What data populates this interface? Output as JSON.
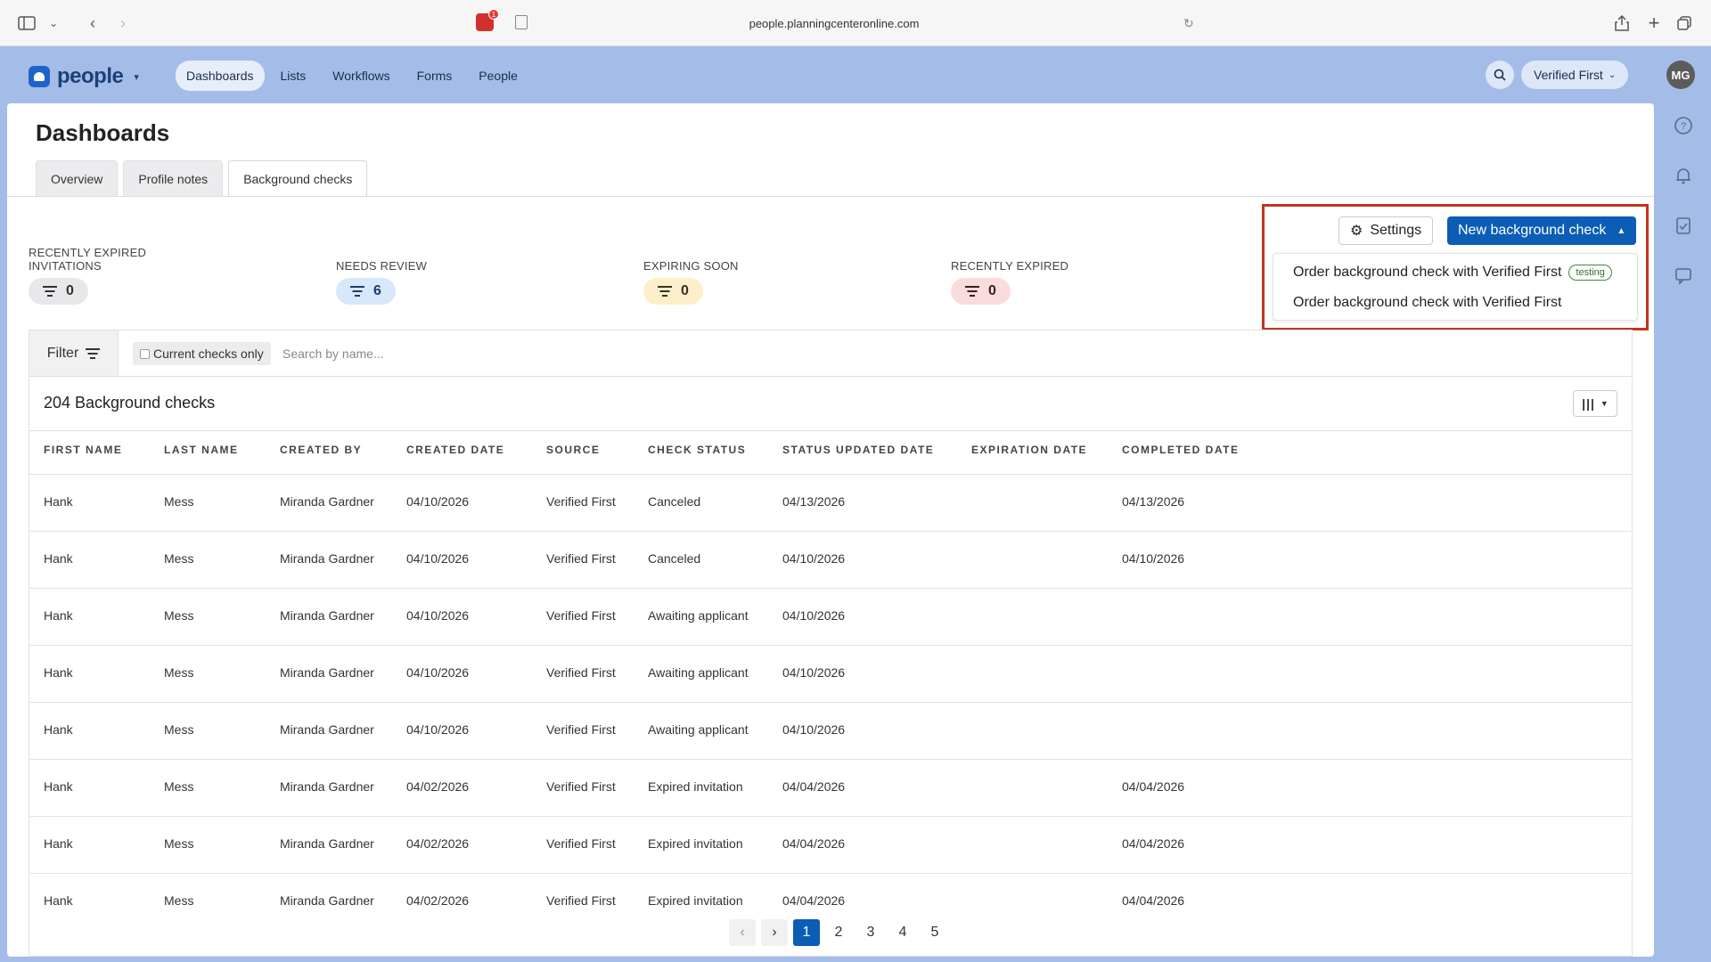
{
  "browser": {
    "url": "people.planningcenteronline.com",
    "ext_badge": "1"
  },
  "app": {
    "logo_text": "people",
    "nav": [
      "Dashboards",
      "Lists",
      "Workflows",
      "Forms",
      "People"
    ],
    "active_nav": "Dashboards",
    "org_label": "Verified First",
    "avatar_initials": "MG"
  },
  "page": {
    "title": "Dashboards",
    "tabs": [
      "Overview",
      "Profile notes",
      "Background checks"
    ],
    "active_tab": "Background checks"
  },
  "stats": [
    {
      "label": "RECENTLY EXPIRED INVITATIONS",
      "value": "0",
      "color": "gray"
    },
    {
      "label": "NEEDS REVIEW",
      "value": "6",
      "color": "blue"
    },
    {
      "label": "EXPIRING SOON",
      "value": "0",
      "color": "yellow"
    },
    {
      "label": "RECENTLY EXPIRED",
      "value": "0",
      "color": "red"
    }
  ],
  "actions": {
    "settings_label": "Settings",
    "new_label": "New background check",
    "dropdown": [
      {
        "label": "Order background check with Verified First",
        "badge": "testing"
      },
      {
        "label": "Order background check with Verified First",
        "badge": null
      }
    ]
  },
  "filter": {
    "filter_label": "Filter",
    "current_only_label": "Current checks only",
    "search_placeholder": "Search by name..."
  },
  "table": {
    "count_title": "204 Background checks",
    "columns": [
      "FIRST NAME",
      "LAST NAME",
      "CREATED BY",
      "CREATED DATE",
      "SOURCE",
      "CHECK STATUS",
      "STATUS UPDATED DATE",
      "EXPIRATION DATE",
      "COMPLETED DATE"
    ],
    "rows": [
      [
        "Hank",
        "Mess",
        "Miranda Gardner",
        "04/10/2026",
        "Verified First",
        "Canceled",
        "04/13/2026",
        "",
        "04/13/2026"
      ],
      [
        "Hank",
        "Mess",
        "Miranda Gardner",
        "04/10/2026",
        "Verified First",
        "Canceled",
        "04/10/2026",
        "",
        "04/10/2026"
      ],
      [
        "Hank",
        "Mess",
        "Miranda Gardner",
        "04/10/2026",
        "Verified First",
        "Awaiting applicant",
        "04/10/2026",
        "",
        ""
      ],
      [
        "Hank",
        "Mess",
        "Miranda Gardner",
        "04/10/2026",
        "Verified First",
        "Awaiting applicant",
        "04/10/2026",
        "",
        ""
      ],
      [
        "Hank",
        "Mess",
        "Miranda Gardner",
        "04/10/2026",
        "Verified First",
        "Awaiting applicant",
        "04/10/2026",
        "",
        ""
      ],
      [
        "Hank",
        "Mess",
        "Miranda Gardner",
        "04/02/2026",
        "Verified First",
        "Expired invitation",
        "04/04/2026",
        "",
        "04/04/2026"
      ],
      [
        "Hank",
        "Mess",
        "Miranda Gardner",
        "04/02/2026",
        "Verified First",
        "Expired invitation",
        "04/04/2026",
        "",
        "04/04/2026"
      ],
      [
        "Hank",
        "Mess",
        "Miranda Gardner",
        "04/02/2026",
        "Verified First",
        "Expired invitation",
        "04/04/2026",
        "",
        "04/04/2026"
      ]
    ]
  },
  "pagination": {
    "pages": [
      "1",
      "2",
      "3",
      "4",
      "5"
    ],
    "current": "1"
  }
}
